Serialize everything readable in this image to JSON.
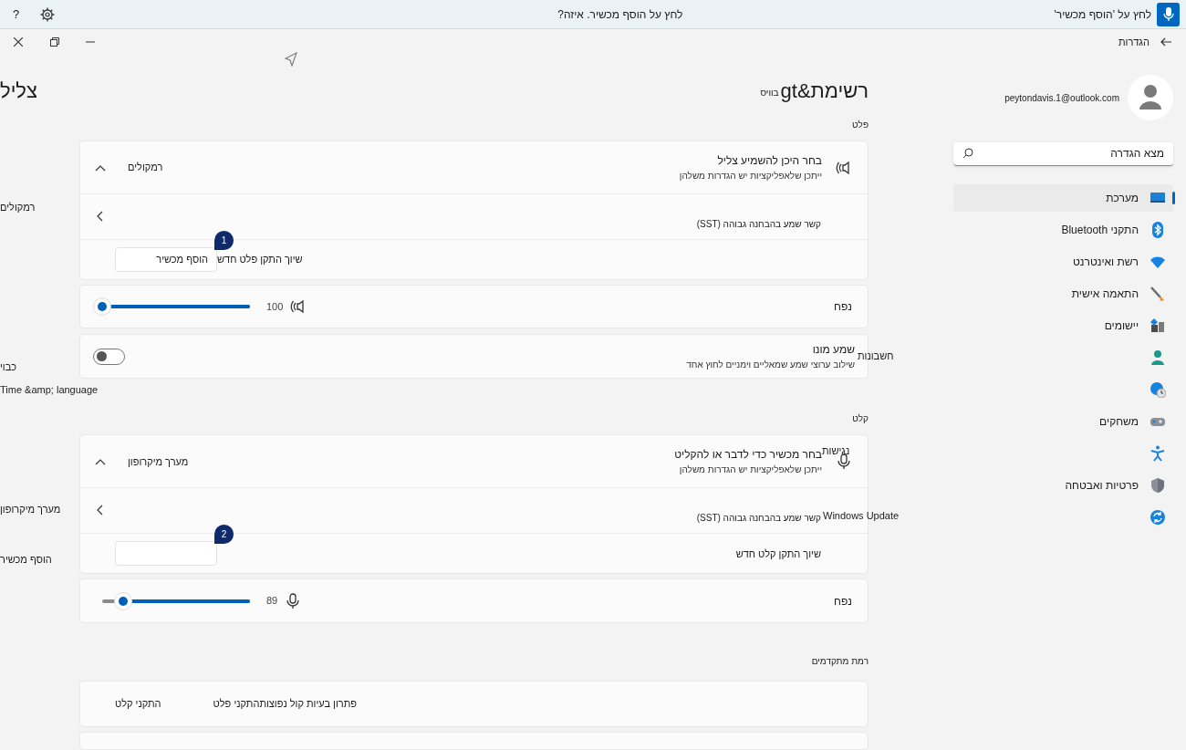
{
  "assist_bar": {
    "prompt": "לחץ על 'הוסף מכשיר'",
    "question": "לחץ על הוסף מכשיר. איזה?",
    "help": "?"
  },
  "window": {
    "title": "הגדרות"
  },
  "account": {
    "email": "peytondavis.1@outlook.com"
  },
  "search": {
    "placeholder": "מצא הגדרה"
  },
  "nav": [
    {
      "label": "מערכת",
      "selected": true
    },
    {
      "label": "התקני Bluetooth",
      "selected": false
    },
    {
      "label": "רשת ואינטרנט",
      "selected": false
    },
    {
      "label": "התאמה אישית",
      "selected": false
    },
    {
      "label": "יישומים",
      "selected": false
    },
    {
      "selected": false
    },
    {
      "selected": false
    },
    {
      "label": "משחקים",
      "selected": false
    },
    {
      "selected": false
    },
    {
      "label": "פרטיות ואבטחה",
      "selected": false
    },
    {
      "selected": false
    }
  ],
  "page": {
    "title": "רשימת&gt",
    "title_fragment": "בוויס",
    "side_title": "צליל"
  },
  "sections": [
    {
      "heading": "פלט",
      "cards": [
        {
          "kind": "group",
          "rows": [
            {
              "kind": "picker",
              "title": "בחר היכן להשמיע צליל",
              "subtitle": "ייתכן שלאפליקציות יש הגדרות משלהן",
              "value": "רמקולים",
              "expanded": true
            },
            {
              "kind": "link",
              "label": "קשר שמע בהבחנה גבוהה (SST)"
            },
            {
              "kind": "pair",
              "label": "שיוך התקן פלט חדש",
              "button": "הוסף מכשיר",
              "badge": "1"
            }
          ]
        },
        {
          "kind": "volume",
          "label": "נפח",
          "reading": "100",
          "level": 1
        },
        {
          "kind": "toggle",
          "title": "שמע מונו",
          "subtitle": "שילוב ערוצי שמע שמאליים וימניים לחוץ אחד",
          "on": false
        }
      ]
    },
    {
      "heading": "קלט",
      "cards": [
        {
          "kind": "group",
          "rows": [
            {
              "kind": "picker",
              "title": "בחר מכשיר כדי לדבר או להקליט",
              "subtitle": "ייתכן שלאפליקציות יש הגדרות משלהן",
              "value": "מערך מיקרופון",
              "expanded": true
            },
            {
              "kind": "link",
              "label": "קשר שמע בהבחנה גבוהה (SST)"
            },
            {
              "kind": "pair",
              "label": "שיוך התקן קלט חדש",
              "badge": "2"
            }
          ]
        },
        {
          "kind": "volume",
          "label": "נפח",
          "reading": "89",
          "level": 0.86
        }
      ]
    },
    {
      "heading": "רמת מתקדמים",
      "cards": [
        {
          "kind": "links",
          "items": [
            "פתרון בעיות קול נפוצות",
            "התקני פלט",
            "התקני קלט"
          ]
        }
      ]
    }
  ],
  "stray_labels": [
    "רמקולים",
    "חשבונות",
    "כבוי",
    "Time &amp; language",
    "נגישות",
    "מערך מיקרופון",
    "Windows Update",
    "הוסף מכשיר"
  ]
}
